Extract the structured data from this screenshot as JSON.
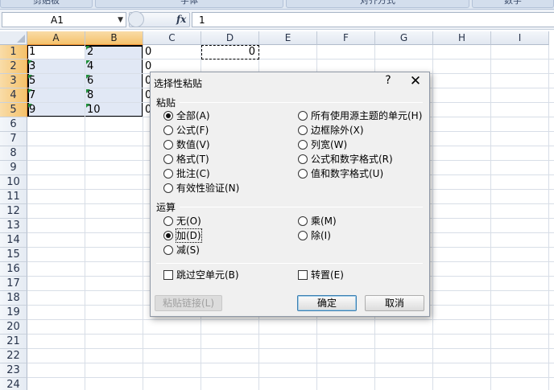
{
  "ribbon": {
    "groups": [
      "剪贴板",
      "字体",
      "对齐方式",
      "数字"
    ]
  },
  "formula_bar": {
    "name_box": "A1",
    "fx_label": "fx",
    "formula_value": "1"
  },
  "sheet": {
    "columns": [
      "A",
      "B",
      "C",
      "D",
      "E",
      "F",
      "G",
      "H",
      "I"
    ],
    "rows": [
      "1",
      "2",
      "3",
      "4",
      "5",
      "6",
      "7",
      "8",
      "9",
      "10",
      "11",
      "12",
      "13",
      "14",
      "15",
      "16",
      "17",
      "18",
      "19",
      "20",
      "21",
      "22",
      "23",
      "24"
    ],
    "cells": {
      "A": [
        "1",
        "3",
        "5",
        "7",
        "9"
      ],
      "B": [
        "2",
        "4",
        "6",
        "8",
        "10"
      ],
      "C": [
        "0",
        "0",
        "0",
        "0",
        "0"
      ],
      "D1": "0"
    }
  },
  "dialog": {
    "title": "选择性粘贴",
    "help": "?",
    "close": "✕",
    "paste_group": "粘贴",
    "paste_left": [
      "全部(A)",
      "公式(F)",
      "数值(V)",
      "格式(T)",
      "批注(C)",
      "有效性验证(N)"
    ],
    "paste_right": [
      "所有使用源主题的单元(H)",
      "边框除外(X)",
      "列宽(W)",
      "公式和数字格式(R)",
      "值和数字格式(U)"
    ],
    "paste_selected": "全部(A)",
    "operation_group": "运算",
    "op_left": [
      "无(O)",
      "加(D)",
      "减(S)"
    ],
    "op_right": [
      "乘(M)",
      "除(I)"
    ],
    "op_selected": "加(D)",
    "skip_blanks": "跳过空单元(B)",
    "skip_blanks_checked": false,
    "transpose": "转置(E)",
    "transpose_checked": false,
    "paste_link": "粘贴链接(L)",
    "ok": "确定",
    "cancel": "取消"
  }
}
